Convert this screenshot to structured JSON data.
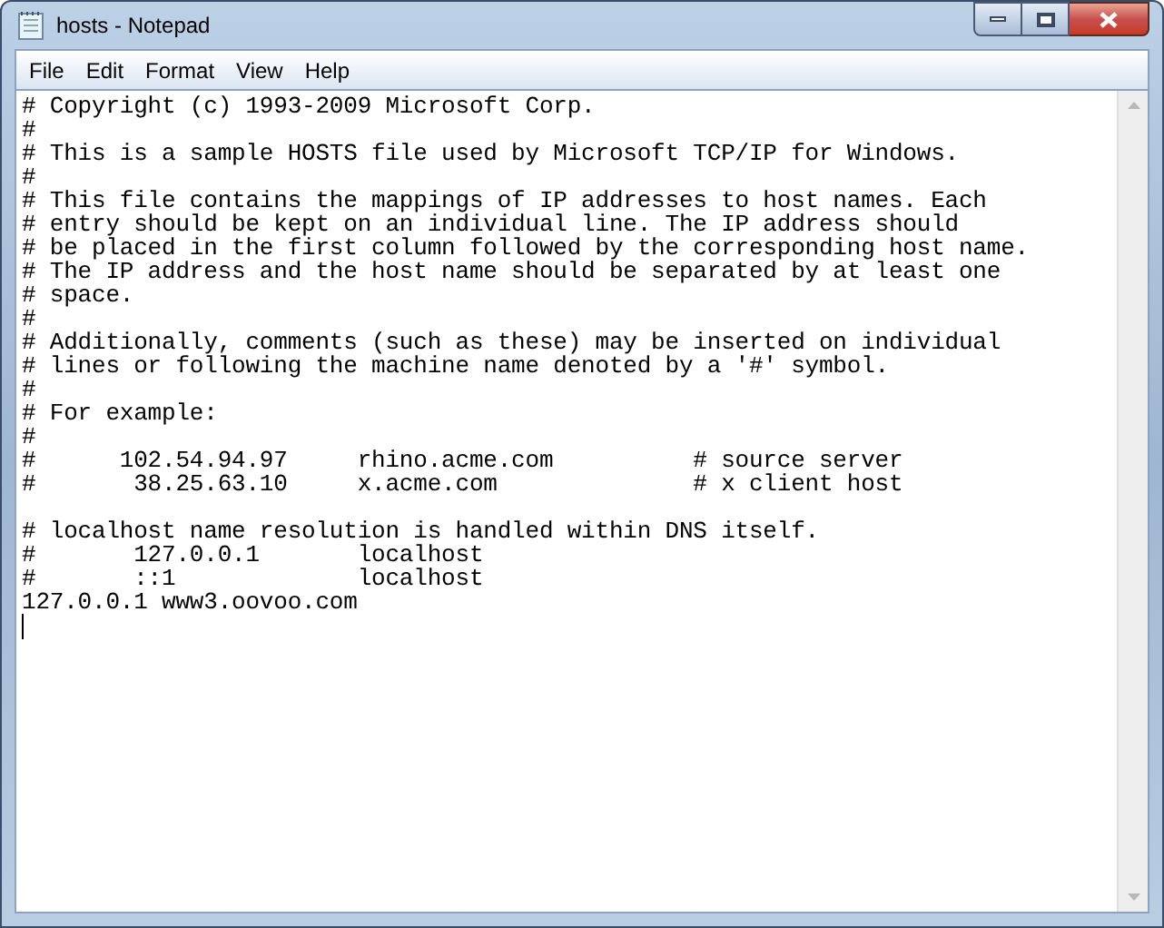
{
  "window": {
    "title": "hosts - Notepad"
  },
  "menu": [
    {
      "label": "File"
    },
    {
      "label": "Edit"
    },
    {
      "label": "Format"
    },
    {
      "label": "View"
    },
    {
      "label": "Help"
    }
  ],
  "editor": {
    "lines": [
      {
        "kind": "text",
        "text": "# Copyright (c) 1993-2009 Microsoft Corp."
      },
      {
        "kind": "text",
        "text": "#"
      },
      {
        "kind": "text",
        "text": "# This is a sample HOSTS file used by Microsoft TCP/IP for Windows."
      },
      {
        "kind": "text",
        "text": "#"
      },
      {
        "kind": "text",
        "text": "# This file contains the mappings of IP addresses to host names. Each"
      },
      {
        "kind": "text",
        "text": "# entry should be kept on an individual line. The IP address should"
      },
      {
        "kind": "text",
        "text": "# be placed in the first column followed by the corresponding host name."
      },
      {
        "kind": "text",
        "text": "# The IP address and the host name should be separated by at least one"
      },
      {
        "kind": "text",
        "text": "# space."
      },
      {
        "kind": "text",
        "text": "#"
      },
      {
        "kind": "text",
        "text": "# Additionally, comments (such as these) may be inserted on individual"
      },
      {
        "kind": "text",
        "text": "# lines or following the machine name denoted by a '#' symbol."
      },
      {
        "kind": "text",
        "text": "#"
      },
      {
        "kind": "text",
        "text": "# For example:"
      },
      {
        "kind": "text",
        "text": "#"
      },
      {
        "kind": "text",
        "text": "#      102.54.94.97     rhino.acme.com          # source server"
      },
      {
        "kind": "text",
        "text": "#       38.25.63.10     x.acme.com              # x client host"
      },
      {
        "kind": "blank"
      },
      {
        "kind": "text",
        "text": "# localhost name resolution is handled within DNS itself."
      },
      {
        "kind": "text",
        "text": "#       127.0.0.1       localhost"
      },
      {
        "kind": "text",
        "text": "#       ::1             localhost"
      },
      {
        "kind": "text",
        "text": "127.0.0.1 www3.oovoo.com"
      },
      {
        "kind": "caret"
      }
    ]
  }
}
